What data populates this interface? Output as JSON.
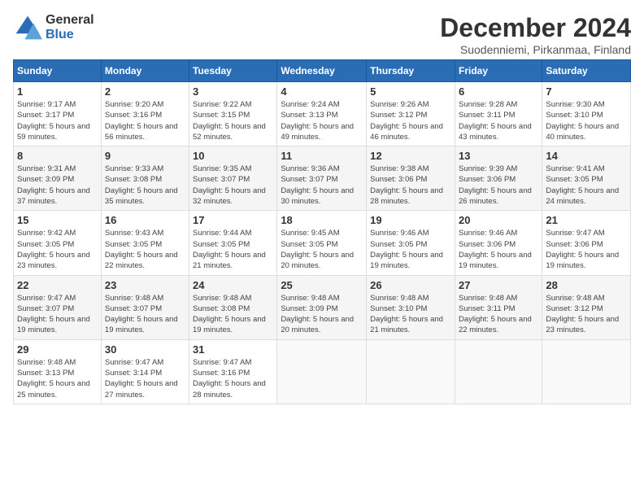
{
  "logo": {
    "general": "General",
    "blue": "Blue"
  },
  "title": "December 2024",
  "subtitle": "Suodenniemi, Pirkanmaa, Finland",
  "header": {
    "days": [
      "Sunday",
      "Monday",
      "Tuesday",
      "Wednesday",
      "Thursday",
      "Friday",
      "Saturday"
    ]
  },
  "weeks": [
    [
      {
        "day": "1",
        "sunrise": "Sunrise: 9:17 AM",
        "sunset": "Sunset: 3:17 PM",
        "daylight": "Daylight: 5 hours and 59 minutes."
      },
      {
        "day": "2",
        "sunrise": "Sunrise: 9:20 AM",
        "sunset": "Sunset: 3:16 PM",
        "daylight": "Daylight: 5 hours and 56 minutes."
      },
      {
        "day": "3",
        "sunrise": "Sunrise: 9:22 AM",
        "sunset": "Sunset: 3:15 PM",
        "daylight": "Daylight: 5 hours and 52 minutes."
      },
      {
        "day": "4",
        "sunrise": "Sunrise: 9:24 AM",
        "sunset": "Sunset: 3:13 PM",
        "daylight": "Daylight: 5 hours and 49 minutes."
      },
      {
        "day": "5",
        "sunrise": "Sunrise: 9:26 AM",
        "sunset": "Sunset: 3:12 PM",
        "daylight": "Daylight: 5 hours and 46 minutes."
      },
      {
        "day": "6",
        "sunrise": "Sunrise: 9:28 AM",
        "sunset": "Sunset: 3:11 PM",
        "daylight": "Daylight: 5 hours and 43 minutes."
      },
      {
        "day": "7",
        "sunrise": "Sunrise: 9:30 AM",
        "sunset": "Sunset: 3:10 PM",
        "daylight": "Daylight: 5 hours and 40 minutes."
      }
    ],
    [
      {
        "day": "8",
        "sunrise": "Sunrise: 9:31 AM",
        "sunset": "Sunset: 3:09 PM",
        "daylight": "Daylight: 5 hours and 37 minutes."
      },
      {
        "day": "9",
        "sunrise": "Sunrise: 9:33 AM",
        "sunset": "Sunset: 3:08 PM",
        "daylight": "Daylight: 5 hours and 35 minutes."
      },
      {
        "day": "10",
        "sunrise": "Sunrise: 9:35 AM",
        "sunset": "Sunset: 3:07 PM",
        "daylight": "Daylight: 5 hours and 32 minutes."
      },
      {
        "day": "11",
        "sunrise": "Sunrise: 9:36 AM",
        "sunset": "Sunset: 3:07 PM",
        "daylight": "Daylight: 5 hours and 30 minutes."
      },
      {
        "day": "12",
        "sunrise": "Sunrise: 9:38 AM",
        "sunset": "Sunset: 3:06 PM",
        "daylight": "Daylight: 5 hours and 28 minutes."
      },
      {
        "day": "13",
        "sunrise": "Sunrise: 9:39 AM",
        "sunset": "Sunset: 3:06 PM",
        "daylight": "Daylight: 5 hours and 26 minutes."
      },
      {
        "day": "14",
        "sunrise": "Sunrise: 9:41 AM",
        "sunset": "Sunset: 3:05 PM",
        "daylight": "Daylight: 5 hours and 24 minutes."
      }
    ],
    [
      {
        "day": "15",
        "sunrise": "Sunrise: 9:42 AM",
        "sunset": "Sunset: 3:05 PM",
        "daylight": "Daylight: 5 hours and 23 minutes."
      },
      {
        "day": "16",
        "sunrise": "Sunrise: 9:43 AM",
        "sunset": "Sunset: 3:05 PM",
        "daylight": "Daylight: 5 hours and 22 minutes."
      },
      {
        "day": "17",
        "sunrise": "Sunrise: 9:44 AM",
        "sunset": "Sunset: 3:05 PM",
        "daylight": "Daylight: 5 hours and 21 minutes."
      },
      {
        "day": "18",
        "sunrise": "Sunrise: 9:45 AM",
        "sunset": "Sunset: 3:05 PM",
        "daylight": "Daylight: 5 hours and 20 minutes."
      },
      {
        "day": "19",
        "sunrise": "Sunrise: 9:46 AM",
        "sunset": "Sunset: 3:05 PM",
        "daylight": "Daylight: 5 hours and 19 minutes."
      },
      {
        "day": "20",
        "sunrise": "Sunrise: 9:46 AM",
        "sunset": "Sunset: 3:06 PM",
        "daylight": "Daylight: 5 hours and 19 minutes."
      },
      {
        "day": "21",
        "sunrise": "Sunrise: 9:47 AM",
        "sunset": "Sunset: 3:06 PM",
        "daylight": "Daylight: 5 hours and 19 minutes."
      }
    ],
    [
      {
        "day": "22",
        "sunrise": "Sunrise: 9:47 AM",
        "sunset": "Sunset: 3:07 PM",
        "daylight": "Daylight: 5 hours and 19 minutes."
      },
      {
        "day": "23",
        "sunrise": "Sunrise: 9:48 AM",
        "sunset": "Sunset: 3:07 PM",
        "daylight": "Daylight: 5 hours and 19 minutes."
      },
      {
        "day": "24",
        "sunrise": "Sunrise: 9:48 AM",
        "sunset": "Sunset: 3:08 PM",
        "daylight": "Daylight: 5 hours and 19 minutes."
      },
      {
        "day": "25",
        "sunrise": "Sunrise: 9:48 AM",
        "sunset": "Sunset: 3:09 PM",
        "daylight": "Daylight: 5 hours and 20 minutes."
      },
      {
        "day": "26",
        "sunrise": "Sunrise: 9:48 AM",
        "sunset": "Sunset: 3:10 PM",
        "daylight": "Daylight: 5 hours and 21 minutes."
      },
      {
        "day": "27",
        "sunrise": "Sunrise: 9:48 AM",
        "sunset": "Sunset: 3:11 PM",
        "daylight": "Daylight: 5 hours and 22 minutes."
      },
      {
        "day": "28",
        "sunrise": "Sunrise: 9:48 AM",
        "sunset": "Sunset: 3:12 PM",
        "daylight": "Daylight: 5 hours and 23 minutes."
      }
    ],
    [
      {
        "day": "29",
        "sunrise": "Sunrise: 9:48 AM",
        "sunset": "Sunset: 3:13 PM",
        "daylight": "Daylight: 5 hours and 25 minutes."
      },
      {
        "day": "30",
        "sunrise": "Sunrise: 9:47 AM",
        "sunset": "Sunset: 3:14 PM",
        "daylight": "Daylight: 5 hours and 27 minutes."
      },
      {
        "day": "31",
        "sunrise": "Sunrise: 9:47 AM",
        "sunset": "Sunset: 3:16 PM",
        "daylight": "Daylight: 5 hours and 28 minutes."
      },
      null,
      null,
      null,
      null
    ]
  ]
}
